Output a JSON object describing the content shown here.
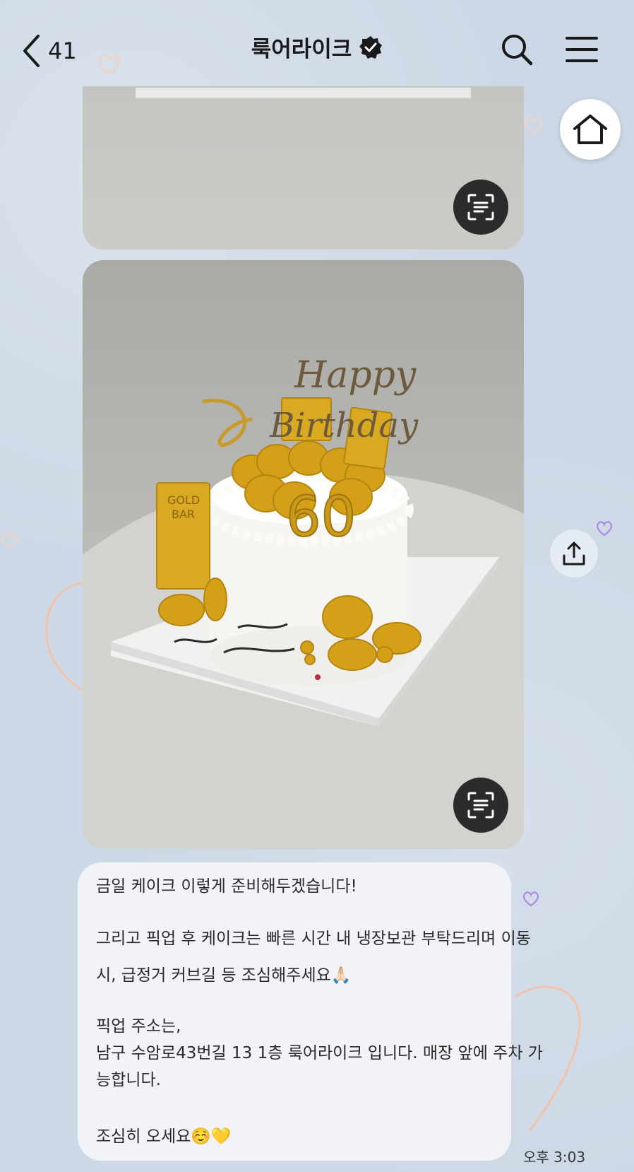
{
  "header": {
    "back_count": "41",
    "title": "룩어라이크",
    "verified": true
  },
  "icons": {
    "back": "chevron-left-icon",
    "verified": "verified-badge-icon",
    "search": "search-icon",
    "menu": "hamburger-menu-icon",
    "home": "home-icon",
    "share": "share-icon",
    "scan": "text-scan-icon"
  },
  "photos": [
    {
      "name": "cake-photo-top",
      "content": "cropped photo"
    },
    {
      "name": "cake-photo-main",
      "content": "cake photo",
      "cake_texts": [
        "Happy",
        "Birthday",
        "60",
        "GOLD",
        "BAR"
      ]
    }
  ],
  "message": {
    "line1": "금일 케이크 이렇게 준비해두겠습니다!",
    "line2": "그리고 픽업 후 케이크는 빠른 시간 내 냉장보관 부탁드리며 이동",
    "line3": "시, 급정거 커브길 등 조심해주세요🙏🏻",
    "line4": "픽업 주소는,",
    "line5": "남구 수암로43번길 13 1층 룩어라이크 입니다. 매장 앞에 주차 가",
    "line6": "능합니다.",
    "line7": "조심히 오세요☺️💛",
    "time": "오후 3:03"
  },
  "colors": {
    "background": "#cdd8e6",
    "bubble": "#f1f3f6",
    "scan_button": "#2b2b2b",
    "gold": "#d4a017",
    "heart_purple": "#a98de0",
    "heart_orange": "#f0b89a"
  }
}
